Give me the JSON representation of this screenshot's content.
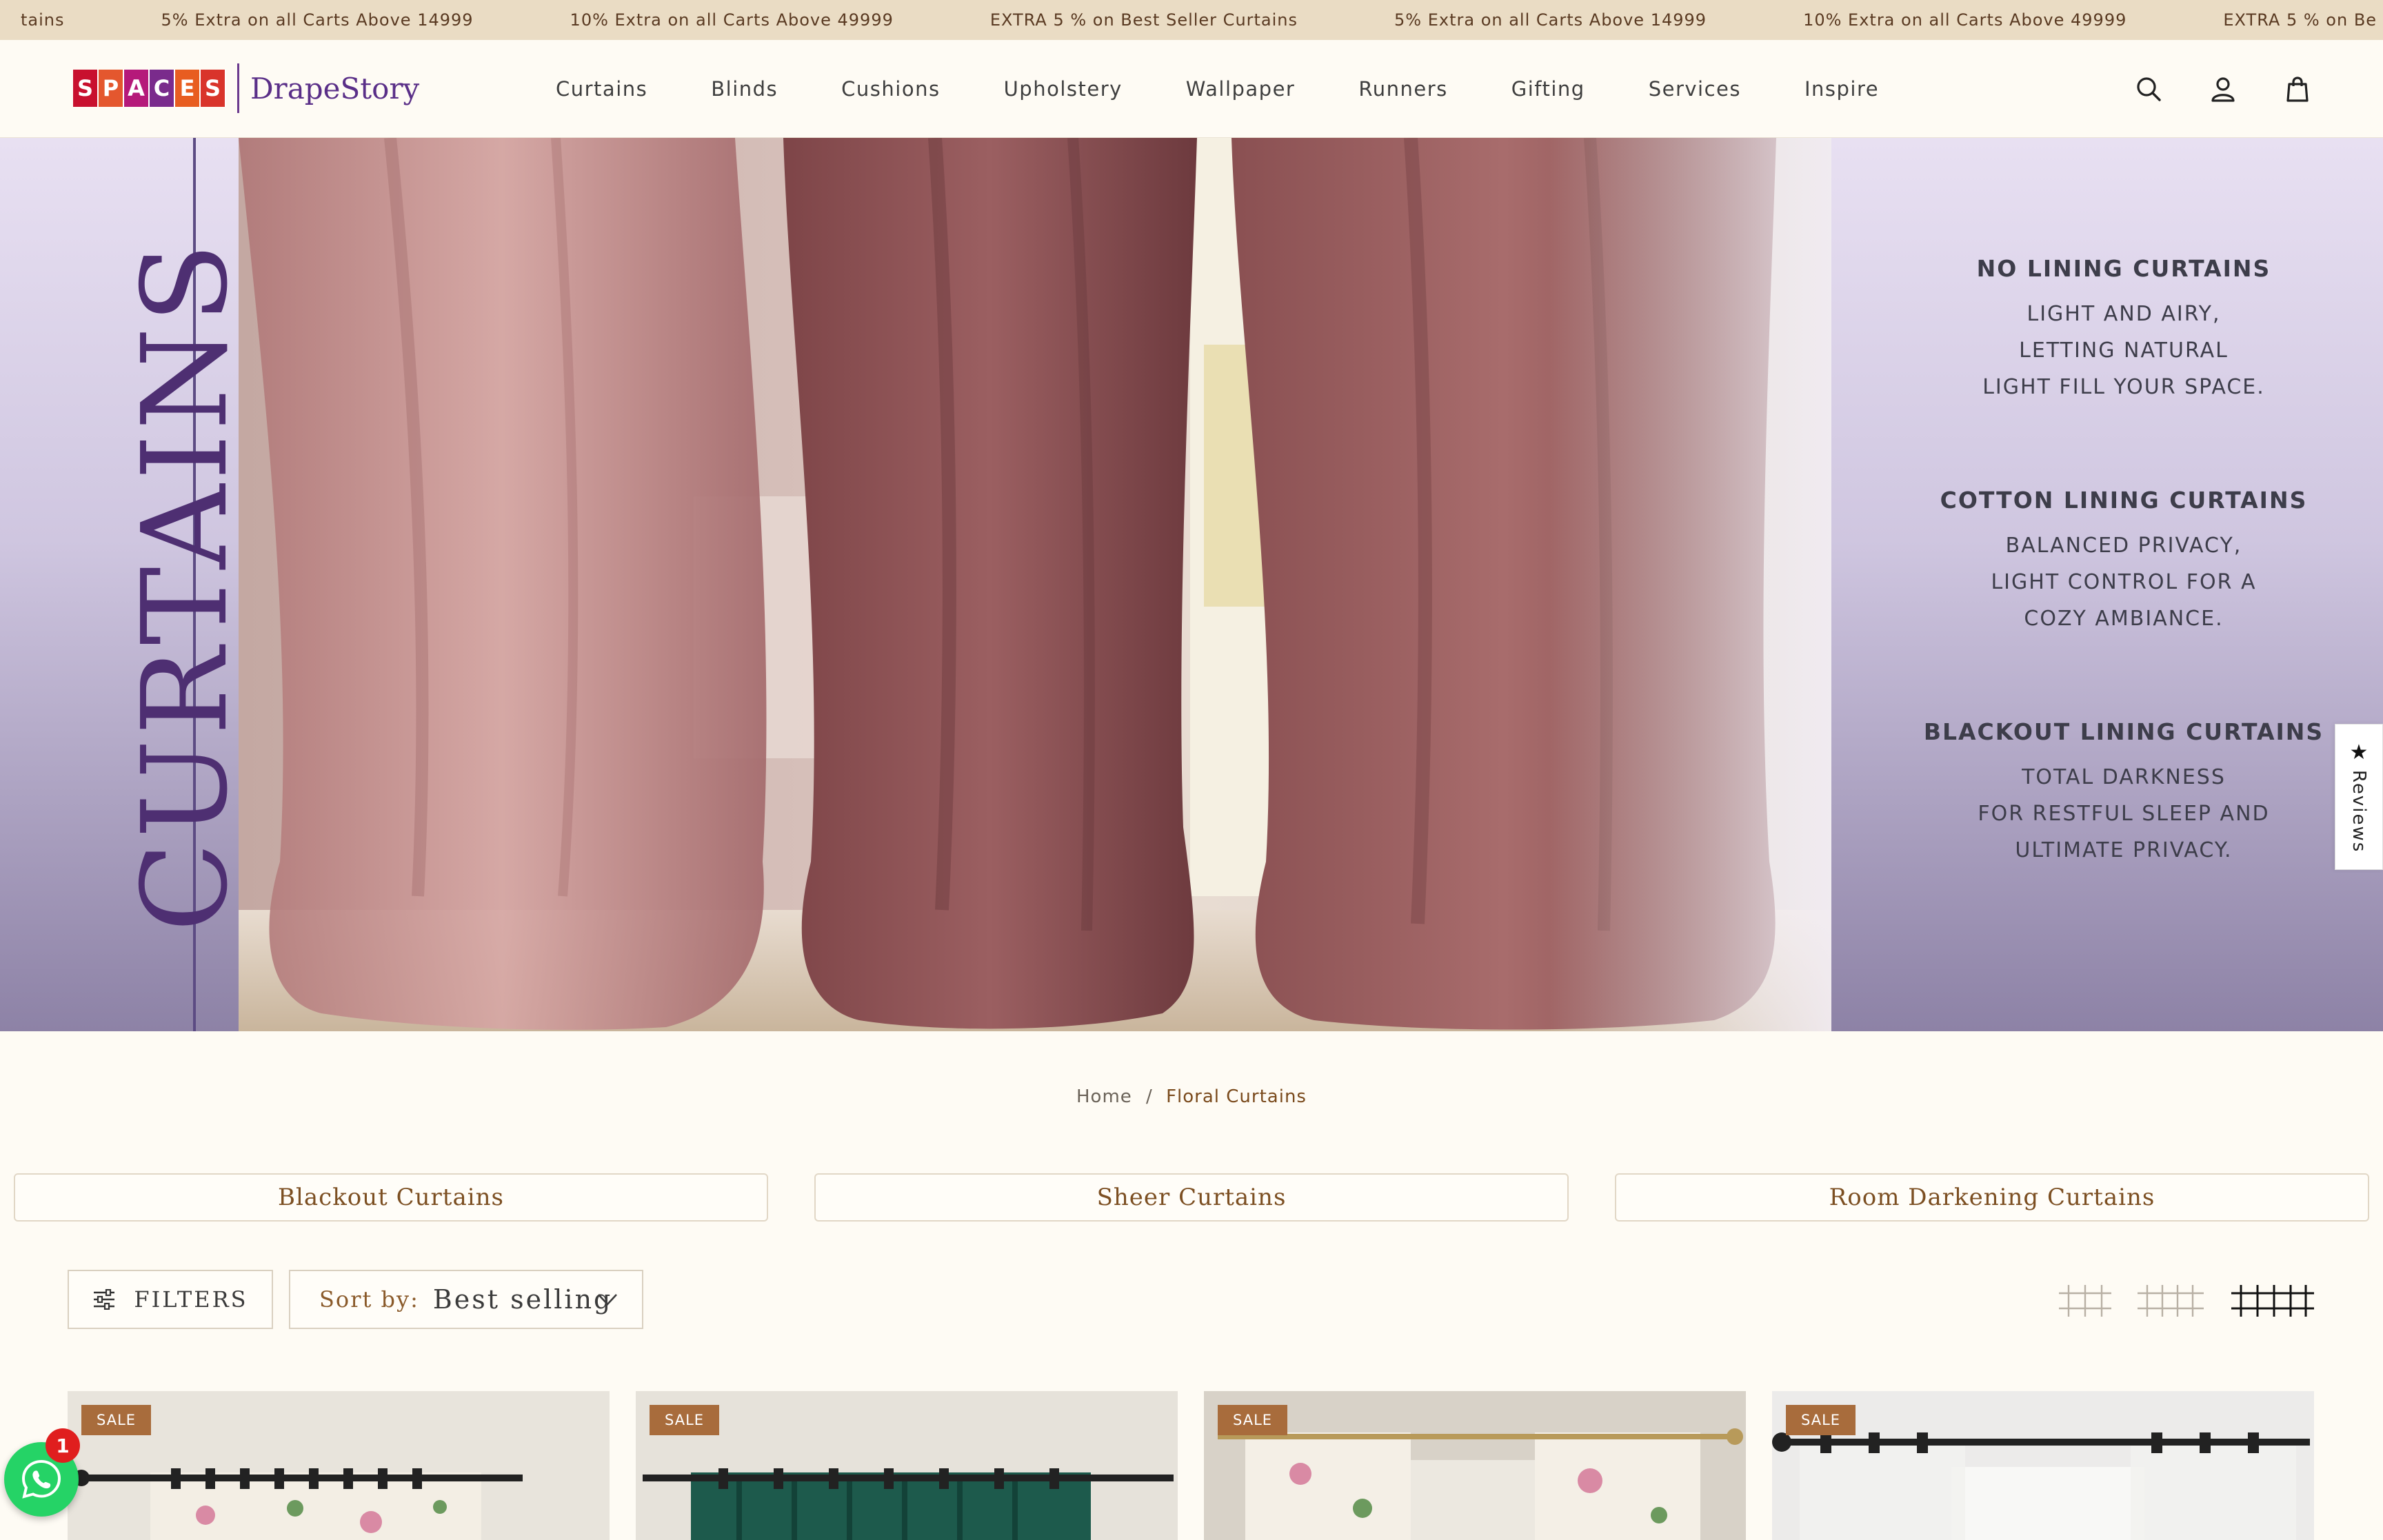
{
  "announcements": [
    "tains",
    "5% Extra on all Carts Above 14999",
    "10% Extra on all Carts Above 49999",
    "EXTRA 5 % on Best Seller Curtains",
    "5% Extra on all Carts Above 14999",
    "10% Extra on all Carts Above 49999",
    "EXTRA 5 % on Be"
  ],
  "logo": {
    "spaces_letters": [
      "S",
      "P",
      "A",
      "C",
      "E",
      "S"
    ],
    "spaces_colors": [
      "#c8102e",
      "#e4572e",
      "#b5197a",
      "#7a2b8c",
      "#e85d20",
      "#d9342b"
    ],
    "drape_text": "DrapeStory"
  },
  "nav": [
    "Curtains",
    "Blinds",
    "Cushions",
    "Upholstery",
    "Wallpaper",
    "Runners",
    "Gifting",
    "Services",
    "Inspire"
  ],
  "header_icons": [
    "search-icon",
    "account-icon",
    "cart-icon"
  ],
  "hero": {
    "word": "CURTAINS",
    "blocks": [
      {
        "title": "NO LINING CURTAINS",
        "lines": [
          "LIGHT AND AIRY,",
          "LETTING NATURAL",
          "LIGHT FILL YOUR SPACE."
        ]
      },
      {
        "title": "COTTON LINING CURTAINS",
        "lines": [
          "BALANCED PRIVACY,",
          "LIGHT CONTROL FOR A",
          "COZY AMBIANCE."
        ]
      },
      {
        "title": "BLACKOUT LINING CURTAINS",
        "lines": [
          "TOTAL DARKNESS",
          "FOR RESTFUL SLEEP AND",
          "ULTIMATE PRIVACY."
        ]
      }
    ]
  },
  "breadcrumb": {
    "home": "Home",
    "separator": "/",
    "current": "Floral Curtains"
  },
  "categories": [
    "Blackout Curtains",
    "Sheer Curtains",
    "Room Darkening Curtains"
  ],
  "toolbar": {
    "filters_label": "FILTERS",
    "sort_label": "Sort by:",
    "sort_value": "Best selling"
  },
  "products": [
    {
      "badge": "SALE"
    },
    {
      "badge": "SALE"
    },
    {
      "badge": "SALE"
    },
    {
      "badge": "SALE"
    }
  ],
  "reviews_tab": {
    "star": "★",
    "label": "Reviews"
  },
  "whatsapp": {
    "badge_count": "1"
  },
  "colors": {
    "announce_bg": "#eadcc4",
    "accent_brown": "#7c4f22",
    "sale_badge": "#a86c3c",
    "brand_purple": "#5a2f88"
  }
}
